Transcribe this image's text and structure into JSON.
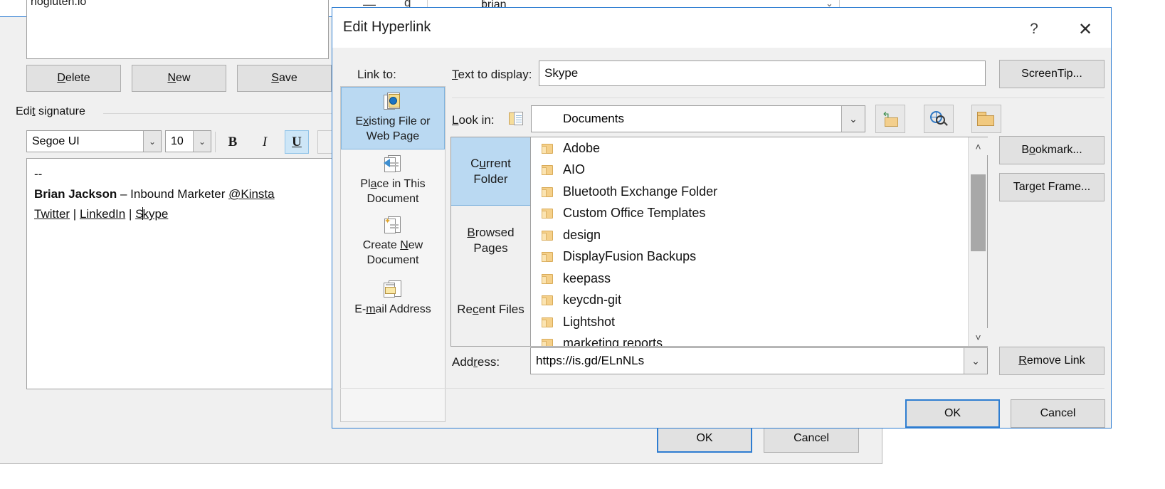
{
  "background_window": {
    "top_row_partial_text": "brian",
    "signature_list": {
      "visible_item": "nogluten.io"
    },
    "buttons": {
      "delete": "Delete",
      "delete_accel": "D",
      "new": "New",
      "new_accel": "N",
      "save": "Save",
      "save_accel": "S"
    },
    "edit_signature_label": "Edit signature",
    "edit_signature_accel": "t",
    "font_family_value": "Segoe UI",
    "font_size_value": "10",
    "format_buttons": {
      "bold": "B",
      "italic": "I",
      "underline": "U"
    },
    "signature_body": {
      "line1": "--",
      "line2_name": "Brian Jackson",
      "line2_rest": " – Inbound Marketer ",
      "line2_handle": "@Kinsta",
      "line3_links": [
        "Twitter",
        "LinkedIn",
        "Skype"
      ],
      "line3_separator": " | "
    },
    "ok_label": "OK",
    "cancel_label": "Cancel"
  },
  "dialog": {
    "title": "Edit Hyperlink",
    "help_icon": "question-mark-icon",
    "close_icon": "close-x-icon",
    "link_to_label": "Link to:",
    "link_to_items": [
      {
        "label_pre": "E",
        "accel": "x",
        "label_post": "isting File or",
        "label_line2": "Web Page",
        "icon": "existing-file-web-page-icon",
        "selected": true
      },
      {
        "label_pre": "Pl",
        "accel": "a",
        "label_post": "ce in This",
        "label_line2": "Document",
        "icon": "place-in-document-icon",
        "selected": false
      },
      {
        "label_pre": "Create ",
        "accel": "N",
        "label_post": "ew",
        "label_line2": "Document",
        "icon": "create-new-document-icon",
        "selected": false
      },
      {
        "label_pre": "E-",
        "accel": "m",
        "label_post": "ail Address",
        "label_line2": "",
        "icon": "email-address-icon",
        "selected": false
      }
    ],
    "text_to_display_label_pre": "",
    "text_to_display_accel": "T",
    "text_to_display_label_post": "ext to display:",
    "text_to_display_value": "Skype",
    "screentip_button": "ScreenTip...",
    "look_in_label_pre": "",
    "look_in_accel": "L",
    "look_in_label_post": "ook in:",
    "look_in_value": "Documents",
    "toolbar_icons": [
      "up-one-folder-icon",
      "browse-the-web-icon",
      "browse-for-file-icon"
    ],
    "bookmark_button": "Bookmark...",
    "bookmark_accel": "o",
    "target_frame_button": "Target Frame...",
    "target_frame_accel": "g",
    "remove_link_button": "Remove Link",
    "remove_link_accel": "R",
    "browse_tabs": [
      {
        "line1_pre": "C",
        "accel": "u",
        "line1_post": "rrent",
        "line2": "Folder",
        "selected": true
      },
      {
        "line1_pre": "",
        "accel": "B",
        "line1_post": "rowsed",
        "line2": "Pages",
        "selected": false
      },
      {
        "line1_pre": "Re",
        "accel": "c",
        "line1_post": "ent Files",
        "line2": "",
        "selected": false
      }
    ],
    "file_list": [
      "Adobe",
      "AIO",
      "Bluetooth Exchange Folder",
      "Custom Office Templates",
      "design",
      "DisplayFusion Backups",
      "keepass",
      "keycdn-git",
      "Lightshot",
      "marketing reports"
    ],
    "scrollbar": {
      "up_arrow": "˄",
      "down_arrow": "˅"
    },
    "address_label_pre": "Add",
    "address_accel": "r",
    "address_label_post": "ess:",
    "address_value": "https://is.gd/ELnNLs",
    "ok_button": "OK",
    "cancel_button": "Cancel"
  },
  "colors": {
    "accent_blue": "#2e7dd1",
    "selection_blue": "#bad9f2",
    "dialog_bg": "#f0f0f0",
    "folder_yellow": "#f5d08a"
  }
}
